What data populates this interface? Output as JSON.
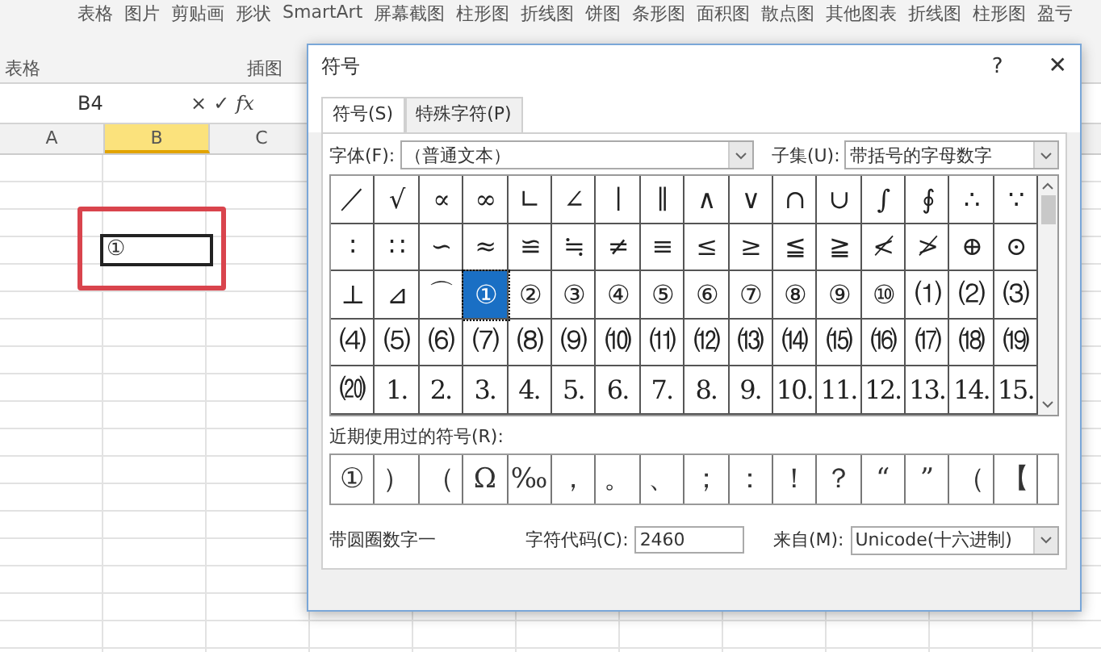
{
  "ribbon": {
    "buttons": [
      "表格",
      "图片",
      "剪贴画",
      "形状",
      "SmartArt",
      "屏幕截图",
      "柱形图",
      "折线图",
      "饼图",
      "条形图",
      "面积图",
      "散点图",
      "其他图表",
      "折线图",
      "柱形图",
      "盈亏"
    ],
    "groups": [
      "表格",
      "插图"
    ]
  },
  "formula_bar": {
    "name_box": "B4",
    "cancel": "×",
    "enter": "✓",
    "function": "fx"
  },
  "sheet": {
    "columns": [
      {
        "label": "A",
        "selected": false
      },
      {
        "label": "B",
        "selected": true
      },
      {
        "label": "C",
        "selected": false
      }
    ],
    "active_cell": {
      "value": "①"
    }
  },
  "dialog": {
    "title": "符号",
    "help": "?",
    "close": "✕",
    "tabs": [
      {
        "label": "符号(S)",
        "selected": true
      },
      {
        "label": "特殊字符(P)",
        "selected": false
      }
    ],
    "font_label": "字体(F):",
    "font_value": "（普通文本）",
    "subset_label": "子集(U):",
    "subset_value": "带括号的字母数字",
    "symbols": [
      {
        "char": "／",
        "selected": false
      },
      {
        "char": "√",
        "selected": false
      },
      {
        "char": "∝",
        "selected": false
      },
      {
        "char": "∞",
        "selected": false
      },
      {
        "char": "∟",
        "selected": false
      },
      {
        "char": "∠",
        "selected": false
      },
      {
        "char": "∣",
        "selected": false
      },
      {
        "char": "∥",
        "selected": false
      },
      {
        "char": "∧",
        "selected": false
      },
      {
        "char": "∨",
        "selected": false
      },
      {
        "char": "∩",
        "selected": false
      },
      {
        "char": "∪",
        "selected": false
      },
      {
        "char": "∫",
        "selected": false
      },
      {
        "char": "∮",
        "selected": false
      },
      {
        "char": "∴",
        "selected": false
      },
      {
        "char": "∵",
        "selected": false
      },
      {
        "char": "∶",
        "selected": false
      },
      {
        "char": "∷",
        "selected": false
      },
      {
        "char": "∽",
        "selected": false
      },
      {
        "char": "≈",
        "selected": false
      },
      {
        "char": "≌",
        "selected": false
      },
      {
        "char": "≒",
        "selected": false
      },
      {
        "char": "≠",
        "selected": false
      },
      {
        "char": "≡",
        "selected": false
      },
      {
        "char": "≤",
        "selected": false
      },
      {
        "char": "≥",
        "selected": false
      },
      {
        "char": "≦",
        "selected": false
      },
      {
        "char": "≧",
        "selected": false
      },
      {
        "char": "≮",
        "selected": false
      },
      {
        "char": "≯",
        "selected": false
      },
      {
        "char": "⊕",
        "selected": false
      },
      {
        "char": "⊙",
        "selected": false
      },
      {
        "char": "⊥",
        "selected": false
      },
      {
        "char": "⊿",
        "selected": false
      },
      {
        "char": "⌒",
        "selected": false
      },
      {
        "char": "①",
        "selected": true
      },
      {
        "char": "②",
        "selected": false
      },
      {
        "char": "③",
        "selected": false
      },
      {
        "char": "④",
        "selected": false
      },
      {
        "char": "⑤",
        "selected": false
      },
      {
        "char": "⑥",
        "selected": false
      },
      {
        "char": "⑦",
        "selected": false
      },
      {
        "char": "⑧",
        "selected": false
      },
      {
        "char": "⑨",
        "selected": false
      },
      {
        "char": "⑩",
        "selected": false
      },
      {
        "char": "⑴",
        "selected": false
      },
      {
        "char": "⑵",
        "selected": false
      },
      {
        "char": "⑶",
        "selected": false
      },
      {
        "char": "⑷",
        "selected": false
      },
      {
        "char": "⑸",
        "selected": false
      },
      {
        "char": "⑹",
        "selected": false
      },
      {
        "char": "⑺",
        "selected": false
      },
      {
        "char": "⑻",
        "selected": false
      },
      {
        "char": "⑼",
        "selected": false
      },
      {
        "char": "⑽",
        "selected": false
      },
      {
        "char": "⑾",
        "selected": false
      },
      {
        "char": "⑿",
        "selected": false
      },
      {
        "char": "⒀",
        "selected": false
      },
      {
        "char": "⒁",
        "selected": false
      },
      {
        "char": "⒂",
        "selected": false
      },
      {
        "char": "⒃",
        "selected": false
      },
      {
        "char": "⒄",
        "selected": false
      },
      {
        "char": "⒅",
        "selected": false
      },
      {
        "char": "⒆",
        "selected": false
      },
      {
        "char": "⒇",
        "selected": false
      },
      {
        "char": "1.",
        "selected": false
      },
      {
        "char": "2.",
        "selected": false
      },
      {
        "char": "3.",
        "selected": false
      },
      {
        "char": "4.",
        "selected": false
      },
      {
        "char": "5.",
        "selected": false
      },
      {
        "char": "6.",
        "selected": false
      },
      {
        "char": "7.",
        "selected": false
      },
      {
        "char": "8.",
        "selected": false
      },
      {
        "char": "9.",
        "selected": false
      },
      {
        "char": "10.",
        "selected": false
      },
      {
        "char": "11.",
        "selected": false
      },
      {
        "char": "12.",
        "selected": false
      },
      {
        "char": "13.",
        "selected": false
      },
      {
        "char": "14.",
        "selected": false
      },
      {
        "char": "15.",
        "selected": false
      }
    ],
    "recent_label": "近期使用过的符号(R):",
    "recent": [
      "①",
      "）",
      "（",
      "Ω",
      "‰",
      "，",
      "。",
      "、",
      "；",
      "：",
      "！",
      "？",
      "“",
      "”",
      "（",
      "【"
    ],
    "char_name": "带圆圈数字一",
    "code_label": "字符代码(C):",
    "code_value": "2460",
    "from_label": "来自(M):",
    "from_value": "Unicode(十六进制)"
  }
}
